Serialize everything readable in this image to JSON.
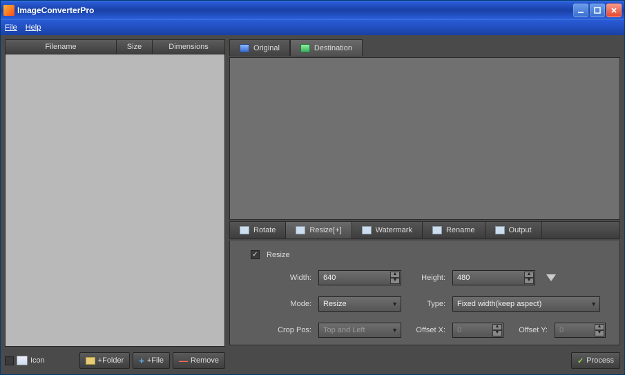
{
  "window": {
    "title": "ImageConverterPro"
  },
  "menu": {
    "file": "File",
    "help": "Help"
  },
  "filelist": {
    "cols": {
      "filename": "Filename",
      "size": "Size",
      "dimensions": "Dimensions"
    }
  },
  "leftfoot": {
    "icon": "Icon",
    "add_folder": "+Folder",
    "add_file": "+File",
    "remove": "Remove"
  },
  "tabs_top": {
    "original": "Original",
    "destination": "Destination"
  },
  "tabs_mid": {
    "rotate": "Rotate",
    "resize": "Resize[+]",
    "watermark": "Watermark",
    "rename": "Rename",
    "output": "Output"
  },
  "resize": {
    "checkbox_label": "Resize",
    "checked": true,
    "width_label": "Width:",
    "width_value": "640",
    "height_label": "Height:",
    "height_value": "480",
    "mode_label": "Mode:",
    "mode_value": "Resize",
    "type_label": "Type:",
    "type_value": "Fixed width(keep aspect)",
    "crop_label": "Crop Pos:",
    "crop_value": "Top and Left",
    "offsetx_label": "Offset X:",
    "offsetx_value": "0",
    "offsety_label": "Offset Y:",
    "offsety_value": "0"
  },
  "process": "Process"
}
